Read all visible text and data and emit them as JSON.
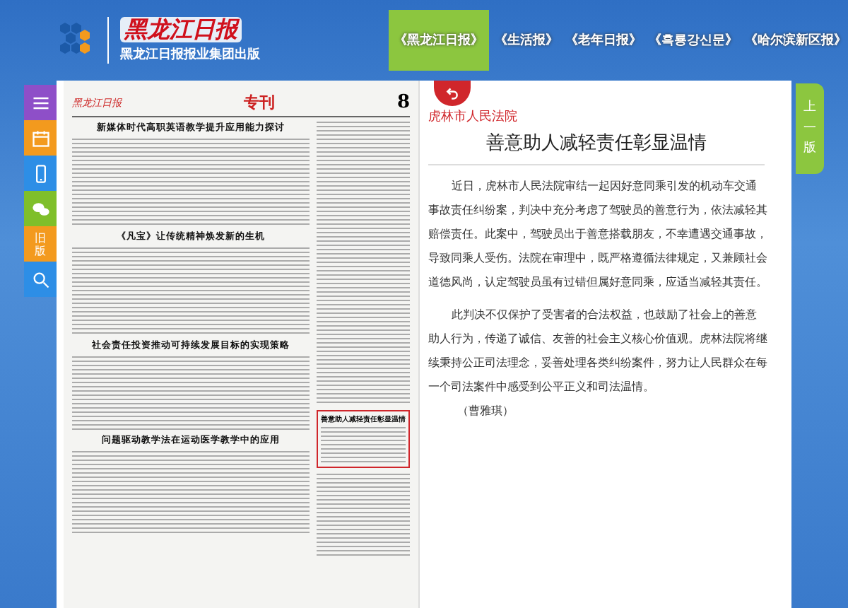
{
  "header": {
    "logo_title": "黑龙江日报",
    "logo_subtitle": "黑龙江日报报业集团出版",
    "tabs": [
      {
        "label": "《黑龙江日报》",
        "selected": true
      },
      {
        "label": "《生活报》",
        "selected": false
      },
      {
        "label": "《老年日报》",
        "selected": false
      },
      {
        "label": "《흑룡강신문》",
        "selected": false
      },
      {
        "label": "《哈尔滨新区报》",
        "selected": false
      }
    ]
  },
  "sidebar": [
    {
      "kind": "menu",
      "color": "#8e4fc8"
    },
    {
      "kind": "calendar",
      "color": "#f39a1e"
    },
    {
      "kind": "phone",
      "color": "#2d8ee6"
    },
    {
      "kind": "wechat",
      "color": "#7fbf2a"
    },
    {
      "kind": "old",
      "color": "#f39a1e",
      "label": "旧版"
    },
    {
      "kind": "search",
      "color": "#2d8ee6"
    }
  ],
  "paper": {
    "masthead": "黑龙江日报",
    "section": "专刊",
    "page_number": "8",
    "headlines": [
      "新媒体时代高职英语教学提升应用能力探讨",
      "《凡宝》让传统精神焕发新的生机",
      "社会责任投资推动可持续发展目标的实现策略",
      "问题驱动教学法在运动医学教学中的应用"
    ],
    "highlighted_headline": "善意助人减轻责任彰显温情"
  },
  "article": {
    "source": "虎林市人民法院",
    "title": "善意助人减轻责任彰显温情",
    "paragraphs": [
      "近日，虎林市人民法院审结一起因好意同乘引发的机动车交通事故责任纠纷案，判决中充分考虑了驾驶员的善意行为，依法减轻其赔偿责任。此案中，驾驶员出于善意搭载朋友，不幸遭遇交通事故，导致同乘人受伤。法院在审理中，既严格遵循法律规定，又兼顾社会道德风尚，认定驾驶员虽有过错但属好意同乘，应适当减轻其责任。",
      "此判决不仅保护了受害者的合法权益，也鼓励了社会上的善意助人行为，传递了诚信、友善的社会主义核心价值观。虎林法院将继续秉持公正司法理念，妥善处理各类纠纷案件，努力让人民群众在每一个司法案件中感受到公平正义和司法温情。"
    ],
    "byline": "（曹雅琪）"
  },
  "prev_page": {
    "label": "上一版"
  }
}
